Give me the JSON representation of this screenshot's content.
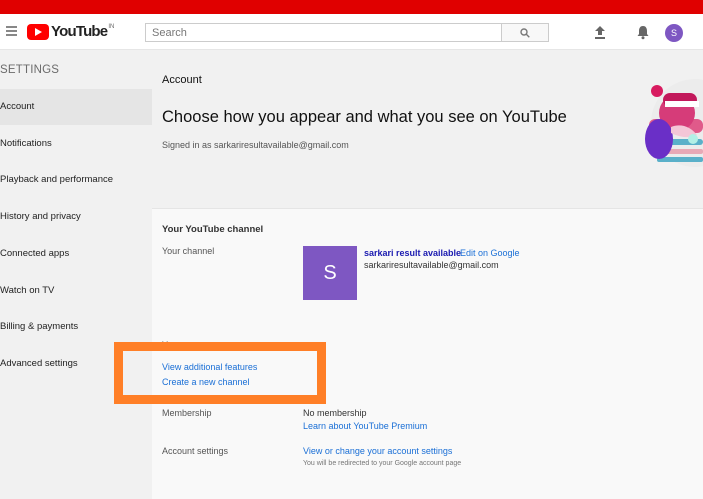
{
  "masthead": {
    "logo_text": "YouTube",
    "country": "IN",
    "search_placeholder": "Search",
    "avatar_letter": "S"
  },
  "sidebar": {
    "title": "SETTINGS",
    "items": [
      {
        "label": "Account"
      },
      {
        "label": "Notifications"
      },
      {
        "label": "Playback and performance"
      },
      {
        "label": "History and privacy"
      },
      {
        "label": "Connected apps"
      },
      {
        "label": "Watch on TV"
      },
      {
        "label": "Billing & payments"
      },
      {
        "label": "Advanced settings"
      }
    ]
  },
  "main": {
    "section_label": "Account",
    "heading": "Choose how you appear and what you see on YouTube",
    "signed_in": "Signed in as sarkariresultavailable@gmail.com",
    "channel_section": {
      "title": "Your YouTube channel",
      "your_channel_label": "Your channel",
      "avatar_letter": "S",
      "channel_name": "sarkari result available",
      "edit_link": "Edit on Google",
      "channel_email": "sarkariresultavailable@gmail.com"
    },
    "your_account": {
      "title": "Your account",
      "view_features": "View additional features",
      "create_channel": "Create a new channel"
    },
    "membership": {
      "label": "Membership",
      "value": "No membership",
      "link": "Learn about YouTube Premium"
    },
    "account_settings": {
      "label": "Account settings",
      "link": "View or change your account settings",
      "note": "You will be redirected to your Google account page"
    }
  },
  "colors": {
    "brand_red": "#ff0000",
    "top_stripe": "#e00000",
    "avatar_purple": "#7e57c2",
    "link_blue": "#1a6fd6",
    "highlight_orange": "#ff7f27"
  }
}
